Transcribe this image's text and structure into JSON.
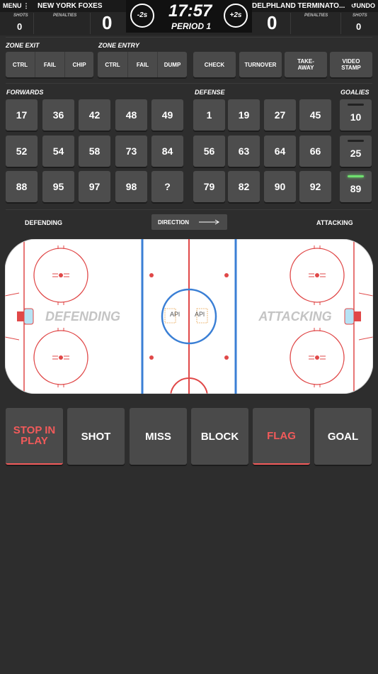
{
  "header": {
    "menu_label": "MENU",
    "undo_label": "UNDO",
    "home_team": "NEW YORK FOXES",
    "away_team": "DELPHLAND TERMINATO...",
    "home_shots_label": "SHOTS",
    "home_shots": "0",
    "home_penalties_label": "PENALTIES",
    "home_score": "0",
    "away_score": "0",
    "away_penalties_label": "PENALTIES",
    "away_shots_label": "SHOTS",
    "away_shots": "0",
    "clock": "17:57",
    "period": "PERIOD 1",
    "minus_label": "-2s",
    "plus_label": "+2s"
  },
  "zone_exit": {
    "label": "ZONE EXIT",
    "options": [
      "CTRL",
      "FAIL",
      "CHIP"
    ]
  },
  "zone_entry": {
    "label": "ZONE ENTRY",
    "options": [
      "CTRL",
      "FAIL",
      "DUMP"
    ]
  },
  "events": [
    "CHECK",
    "TURNOVER",
    "TAKE-\nAWAY",
    "VIDEO\nSTAMP"
  ],
  "forwards": {
    "label": "FORWARDS",
    "numbers": [
      "17",
      "36",
      "42",
      "48",
      "49",
      "52",
      "54",
      "58",
      "73",
      "84",
      "88",
      "95",
      "97",
      "98",
      "?"
    ]
  },
  "defense": {
    "label": "DEFENSE",
    "numbers": [
      "1",
      "19",
      "27",
      "45",
      "56",
      "63",
      "64",
      "66",
      "79",
      "82",
      "90",
      "92"
    ]
  },
  "goalies": {
    "label": "GOALIES",
    "numbers": [
      "10",
      "25",
      "89"
    ],
    "active_index": 2
  },
  "direction": {
    "left_label": "DEFENDING",
    "button_label": "DIRECTION",
    "right_label": "ATTACKING"
  },
  "rink": {
    "left_zone": "DEFENDING",
    "right_zone": "ATTACKING",
    "logo_text": "APl",
    "colors": {
      "red": "#e04848",
      "blue": "#3a7fd5",
      "ice": "#ffffff"
    }
  },
  "actions": [
    "STOP IN\nPLAY",
    "SHOT",
    "MISS",
    "BLOCK",
    "FLAG",
    "GOAL"
  ],
  "colors": {
    "accent_red": "#f25a5a",
    "goalie_active": "#6fe06f",
    "button_bg": "#4d4d4d",
    "background": "#2d2d2d"
  }
}
